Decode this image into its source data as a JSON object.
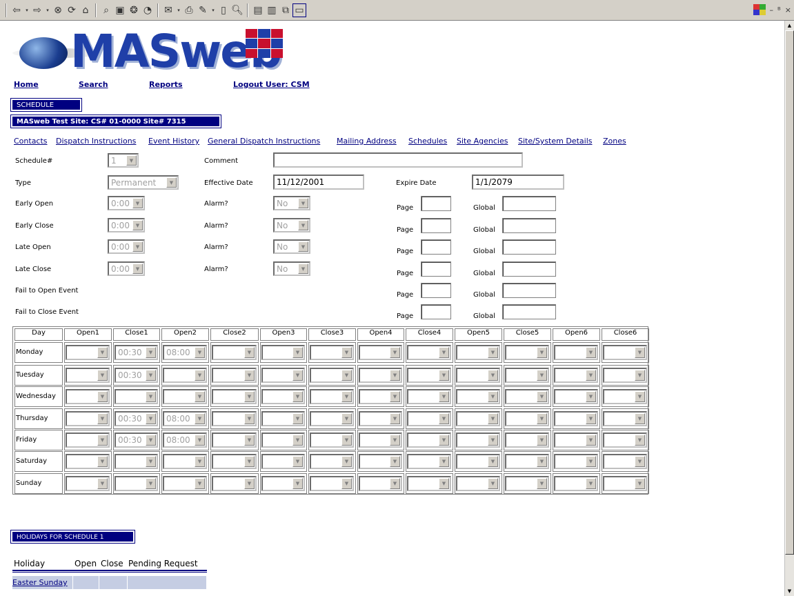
{
  "toolbar": {
    "icons": [
      "back-icon",
      "forward-icon",
      "stop-icon",
      "refresh-icon",
      "home-icon",
      "search-icon",
      "favorites-icon",
      "media-icon",
      "history-icon",
      "mail-icon",
      "print-icon",
      "edit-icon",
      "discuss-icon",
      "preview-icon",
      "folder-icon",
      "folder2-icon",
      "copy-icon",
      "window-icon"
    ]
  },
  "window": {
    "min": "–",
    "max": "ᴮ",
    "close": "×"
  },
  "logo": {
    "text": "MASweb"
  },
  "nav": {
    "home": "Home",
    "search": "Search",
    "reports": "Reports",
    "logout": "Logout User: CSM"
  },
  "schedule_header": "SCHEDULE",
  "site_header": "MASweb Test Site: CS# 01-0000  Site# 7315",
  "sublinks": [
    "Contacts",
    "Dispatch Instructions",
    "Event History",
    "General Dispatch Instructions",
    "Mailing Address",
    "Schedules",
    "Site Agencies",
    "Site/System Details",
    "Zones"
  ],
  "form": {
    "schedule_label": "Schedule#",
    "schedule_value": "1",
    "comment_label": "Comment",
    "comment_value": "",
    "type_label": "Type",
    "type_value": "Permanent",
    "effective_label": "Effective Date",
    "effective_value": "11/12/2001",
    "expire_label": "Expire Date",
    "expire_value": "1/1/2079",
    "early_open_label": "Early Open",
    "early_close_label": "Early Close",
    "late_open_label": "Late Open",
    "late_close_label": "Late Close",
    "fail_open_label": "Fail to Open Event",
    "fail_close_label": "Fail to Close Event",
    "time_value": "0:00",
    "alarm_label": "Alarm?",
    "alarm_value": "No",
    "page_label": "Page",
    "global_label": "Global"
  },
  "grid": {
    "headers": [
      "Day",
      "Open1",
      "Close1",
      "Open2",
      "Close2",
      "Open3",
      "Close3",
      "Open4",
      "Close4",
      "Open5",
      "Close5",
      "Open6",
      "Close6"
    ],
    "rows": [
      {
        "day": "Monday",
        "cells": [
          "",
          "00:30",
          "08:00",
          "",
          "",
          "",
          "",
          "",
          "",
          "",
          "",
          ""
        ]
      },
      {
        "day": "Tuesday",
        "cells": [
          "",
          "00:30",
          "",
          "",
          "",
          "",
          "",
          "",
          "",
          "",
          "",
          ""
        ]
      },
      {
        "day": "Wednesday",
        "cells": [
          "",
          "",
          "",
          "",
          "",
          "",
          "",
          "",
          "",
          "",
          "",
          ""
        ]
      },
      {
        "day": "Thursday",
        "cells": [
          "",
          "00:30",
          "08:00",
          "",
          "",
          "",
          "",
          "",
          "",
          "",
          "",
          ""
        ]
      },
      {
        "day": "Friday",
        "cells": [
          "",
          "00:30",
          "08:00",
          "",
          "",
          "",
          "",
          "",
          "",
          "",
          "",
          ""
        ]
      },
      {
        "day": "Saturday",
        "cells": [
          "",
          "",
          "",
          "",
          "",
          "",
          "",
          "",
          "",
          "",
          "",
          ""
        ]
      },
      {
        "day": "Sunday",
        "cells": [
          "",
          "",
          "",
          "",
          "",
          "",
          "",
          "",
          "",
          "",
          "",
          ""
        ]
      }
    ]
  },
  "holidays": {
    "header": "HOLIDAYS FOR SCHEDULE 1",
    "columns": [
      "Holiday",
      "Open",
      "Close",
      "Pending Request"
    ],
    "rows": [
      {
        "holiday": "Easter Sunday",
        "open": "",
        "close": "",
        "pending": ""
      }
    ]
  }
}
